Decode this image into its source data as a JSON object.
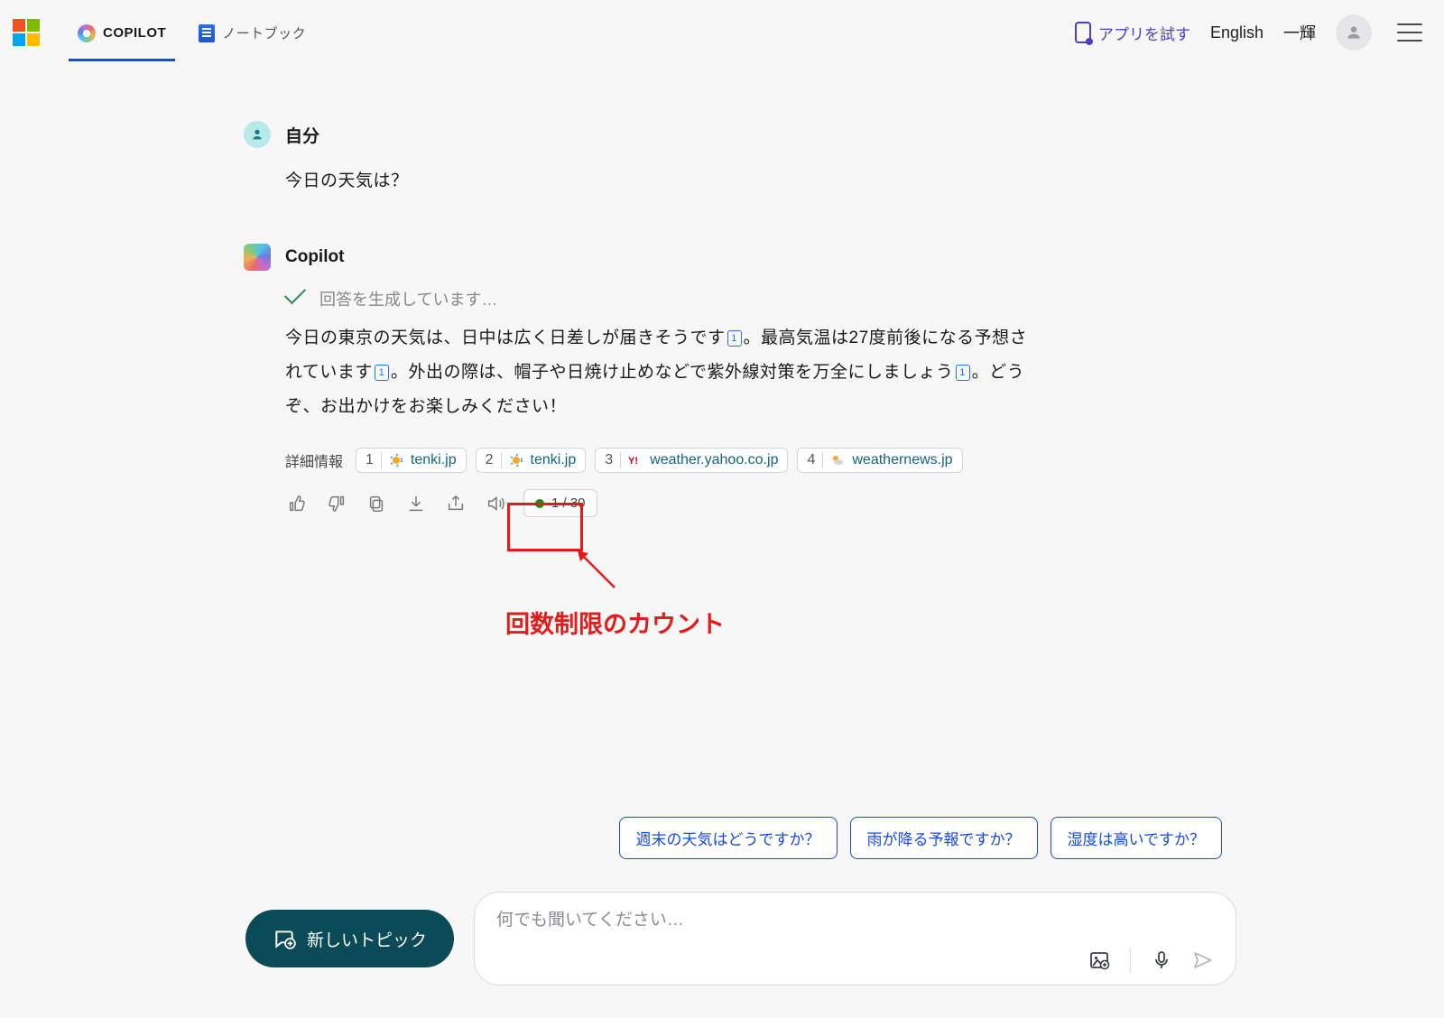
{
  "header": {
    "tab_copilot": "COPILOT",
    "tab_notebook": "ノートブック",
    "try_app": "アプリを試す",
    "language_link": "English",
    "username": "一輝"
  },
  "chat": {
    "user_name": "自分",
    "user_message": "今日の天気は？",
    "bot_name": "Copilot",
    "generating": "回答を生成しています…",
    "response_p1a": "今日の東京の天気は、日中は広く日差しが届きそうです",
    "response_p1b": "。最高気温は27度前後になる予想されています",
    "response_p2a": "。外出の際は、帽子や日焼け止めなどで紫外線対策を万全にしましょう",
    "response_p2b": "。どうぞ、お出かけをお楽しみください！",
    "cite1": "1",
    "cite2": "1",
    "cite3": "1",
    "detail_label": "詳細情報",
    "sources": [
      {
        "n": "1",
        "label": "tenki.jp"
      },
      {
        "n": "2",
        "label": "tenki.jp"
      },
      {
        "n": "3",
        "label": "weather.yahoo.co.jp"
      },
      {
        "n": "4",
        "label": "weathernews.jp"
      }
    ],
    "count": "1 / 30"
  },
  "annotation": {
    "caption": "回数制限のカウント"
  },
  "suggestions": [
    "週末の天気はどうですか？",
    "雨が降る予報ですか？",
    "湿度は高いですか？"
  ],
  "compose": {
    "new_topic": "新しいトピック",
    "placeholder": "何でも聞いてください…"
  }
}
